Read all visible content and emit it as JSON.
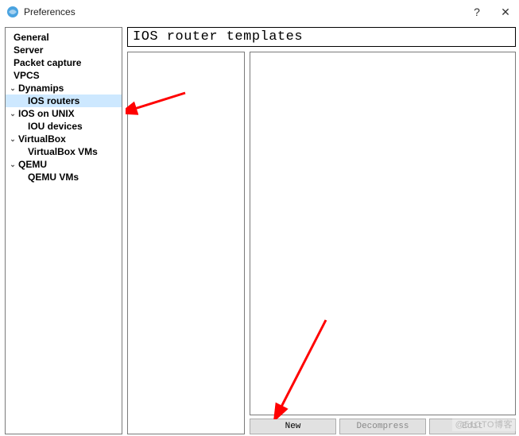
{
  "window": {
    "title": "Preferences",
    "help_symbol": "?",
    "close_symbol": "✕"
  },
  "sidebar": {
    "items": [
      {
        "label": "General",
        "level": 0,
        "expandable": false
      },
      {
        "label": "Server",
        "level": 0,
        "expandable": false
      },
      {
        "label": "Packet capture",
        "level": 0,
        "expandable": false
      },
      {
        "label": "VPCS",
        "level": 0,
        "expandable": false
      },
      {
        "label": "Dynamips",
        "level": 0,
        "expandable": true
      },
      {
        "label": "IOS routers",
        "level": 1,
        "expandable": false,
        "selected": true
      },
      {
        "label": "IOS on UNIX",
        "level": 0,
        "expandable": true
      },
      {
        "label": "IOU devices",
        "level": 1,
        "expandable": false
      },
      {
        "label": "VirtualBox",
        "level": 0,
        "expandable": true
      },
      {
        "label": "VirtualBox VMs",
        "level": 1,
        "expandable": false
      },
      {
        "label": "QEMU",
        "level": 0,
        "expandable": true
      },
      {
        "label": "QEMU VMs",
        "level": 1,
        "expandable": false
      }
    ]
  },
  "main": {
    "panel_title": "IOS router templates",
    "buttons": {
      "new": "New",
      "decompress": "Decompress",
      "edit": "Edit"
    }
  },
  "watermark": "@51CTO博客"
}
